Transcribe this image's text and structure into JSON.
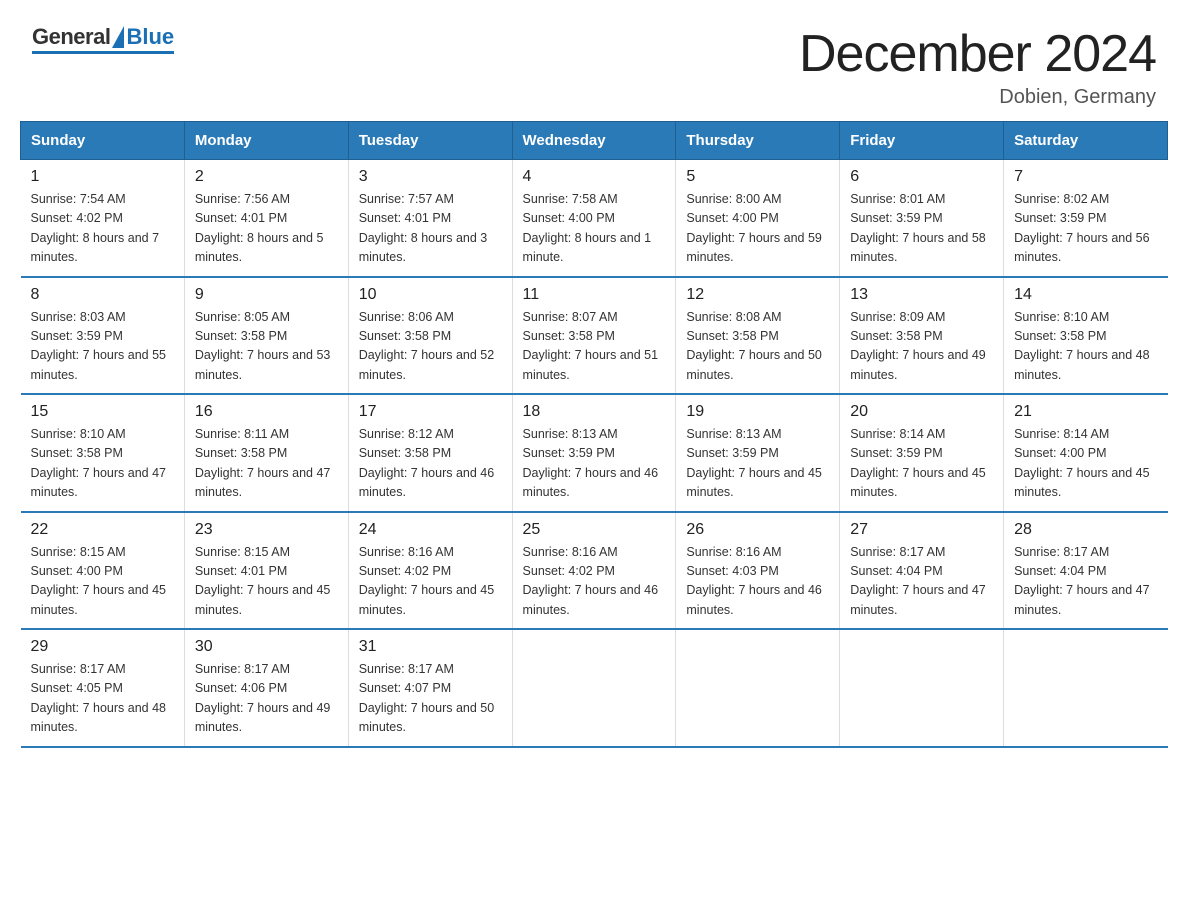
{
  "logo": {
    "general": "General",
    "blue": "Blue"
  },
  "header": {
    "title": "December 2024",
    "location": "Dobien, Germany"
  },
  "days_of_week": [
    "Sunday",
    "Monday",
    "Tuesday",
    "Wednesday",
    "Thursday",
    "Friday",
    "Saturday"
  ],
  "weeks": [
    [
      {
        "day": "1",
        "sunrise": "7:54 AM",
        "sunset": "4:02 PM",
        "daylight": "8 hours and 7 minutes."
      },
      {
        "day": "2",
        "sunrise": "7:56 AM",
        "sunset": "4:01 PM",
        "daylight": "8 hours and 5 minutes."
      },
      {
        "day": "3",
        "sunrise": "7:57 AM",
        "sunset": "4:01 PM",
        "daylight": "8 hours and 3 minutes."
      },
      {
        "day": "4",
        "sunrise": "7:58 AM",
        "sunset": "4:00 PM",
        "daylight": "8 hours and 1 minute."
      },
      {
        "day": "5",
        "sunrise": "8:00 AM",
        "sunset": "4:00 PM",
        "daylight": "7 hours and 59 minutes."
      },
      {
        "day": "6",
        "sunrise": "8:01 AM",
        "sunset": "3:59 PM",
        "daylight": "7 hours and 58 minutes."
      },
      {
        "day": "7",
        "sunrise": "8:02 AM",
        "sunset": "3:59 PM",
        "daylight": "7 hours and 56 minutes."
      }
    ],
    [
      {
        "day": "8",
        "sunrise": "8:03 AM",
        "sunset": "3:59 PM",
        "daylight": "7 hours and 55 minutes."
      },
      {
        "day": "9",
        "sunrise": "8:05 AM",
        "sunset": "3:58 PM",
        "daylight": "7 hours and 53 minutes."
      },
      {
        "day": "10",
        "sunrise": "8:06 AM",
        "sunset": "3:58 PM",
        "daylight": "7 hours and 52 minutes."
      },
      {
        "day": "11",
        "sunrise": "8:07 AM",
        "sunset": "3:58 PM",
        "daylight": "7 hours and 51 minutes."
      },
      {
        "day": "12",
        "sunrise": "8:08 AM",
        "sunset": "3:58 PM",
        "daylight": "7 hours and 50 minutes."
      },
      {
        "day": "13",
        "sunrise": "8:09 AM",
        "sunset": "3:58 PM",
        "daylight": "7 hours and 49 minutes."
      },
      {
        "day": "14",
        "sunrise": "8:10 AM",
        "sunset": "3:58 PM",
        "daylight": "7 hours and 48 minutes."
      }
    ],
    [
      {
        "day": "15",
        "sunrise": "8:10 AM",
        "sunset": "3:58 PM",
        "daylight": "7 hours and 47 minutes."
      },
      {
        "day": "16",
        "sunrise": "8:11 AM",
        "sunset": "3:58 PM",
        "daylight": "7 hours and 47 minutes."
      },
      {
        "day": "17",
        "sunrise": "8:12 AM",
        "sunset": "3:58 PM",
        "daylight": "7 hours and 46 minutes."
      },
      {
        "day": "18",
        "sunrise": "8:13 AM",
        "sunset": "3:59 PM",
        "daylight": "7 hours and 46 minutes."
      },
      {
        "day": "19",
        "sunrise": "8:13 AM",
        "sunset": "3:59 PM",
        "daylight": "7 hours and 45 minutes."
      },
      {
        "day": "20",
        "sunrise": "8:14 AM",
        "sunset": "3:59 PM",
        "daylight": "7 hours and 45 minutes."
      },
      {
        "day": "21",
        "sunrise": "8:14 AM",
        "sunset": "4:00 PM",
        "daylight": "7 hours and 45 minutes."
      }
    ],
    [
      {
        "day": "22",
        "sunrise": "8:15 AM",
        "sunset": "4:00 PM",
        "daylight": "7 hours and 45 minutes."
      },
      {
        "day": "23",
        "sunrise": "8:15 AM",
        "sunset": "4:01 PM",
        "daylight": "7 hours and 45 minutes."
      },
      {
        "day": "24",
        "sunrise": "8:16 AM",
        "sunset": "4:02 PM",
        "daylight": "7 hours and 45 minutes."
      },
      {
        "day": "25",
        "sunrise": "8:16 AM",
        "sunset": "4:02 PM",
        "daylight": "7 hours and 46 minutes."
      },
      {
        "day": "26",
        "sunrise": "8:16 AM",
        "sunset": "4:03 PM",
        "daylight": "7 hours and 46 minutes."
      },
      {
        "day": "27",
        "sunrise": "8:17 AM",
        "sunset": "4:04 PM",
        "daylight": "7 hours and 47 minutes."
      },
      {
        "day": "28",
        "sunrise": "8:17 AM",
        "sunset": "4:04 PM",
        "daylight": "7 hours and 47 minutes."
      }
    ],
    [
      {
        "day": "29",
        "sunrise": "8:17 AM",
        "sunset": "4:05 PM",
        "daylight": "7 hours and 48 minutes."
      },
      {
        "day": "30",
        "sunrise": "8:17 AM",
        "sunset": "4:06 PM",
        "daylight": "7 hours and 49 minutes."
      },
      {
        "day": "31",
        "sunrise": "8:17 AM",
        "sunset": "4:07 PM",
        "daylight": "7 hours and 50 minutes."
      },
      null,
      null,
      null,
      null
    ]
  ]
}
